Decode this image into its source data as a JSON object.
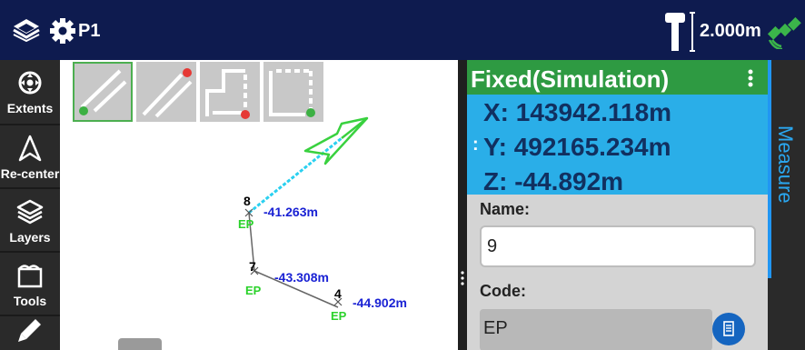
{
  "header": {
    "project": "P1",
    "antenna_height": "2.000m"
  },
  "sidebar": {
    "items": [
      {
        "label": "Extents",
        "icon": "extents-icon"
      },
      {
        "label": "Re-center",
        "icon": "recenter-icon"
      },
      {
        "label": "Layers",
        "icon": "layers-icon"
      },
      {
        "label": "Tools",
        "icon": "tools-icon"
      },
      {
        "label": "",
        "icon": "pencil-icon"
      }
    ]
  },
  "map": {
    "points": [
      {
        "id": "8",
        "code": "EP",
        "elevation": "-41.263m"
      },
      {
        "id": "7",
        "code": "EP",
        "elevation": "-43.308m"
      },
      {
        "id": "4",
        "code": "EP",
        "elevation": "-44.902m"
      }
    ]
  },
  "status": {
    "label": "Fixed(Simulation)"
  },
  "coords": {
    "x": "X: 143942.118m",
    "y": "Y: 492165.234m",
    "z": "Z: -44.892m"
  },
  "form": {
    "name_label": "Name:",
    "name_value": "9",
    "code_label": "Code:",
    "code_value": "EP"
  },
  "measure_tab": {
    "label": "Measure"
  },
  "colors": {
    "topbar": "#0e1b4f",
    "status_fixed": "#2e9a42",
    "coords_bg": "#2aaee8",
    "elevation_text": "#1a22d4",
    "point_code": "#2bd22b"
  }
}
